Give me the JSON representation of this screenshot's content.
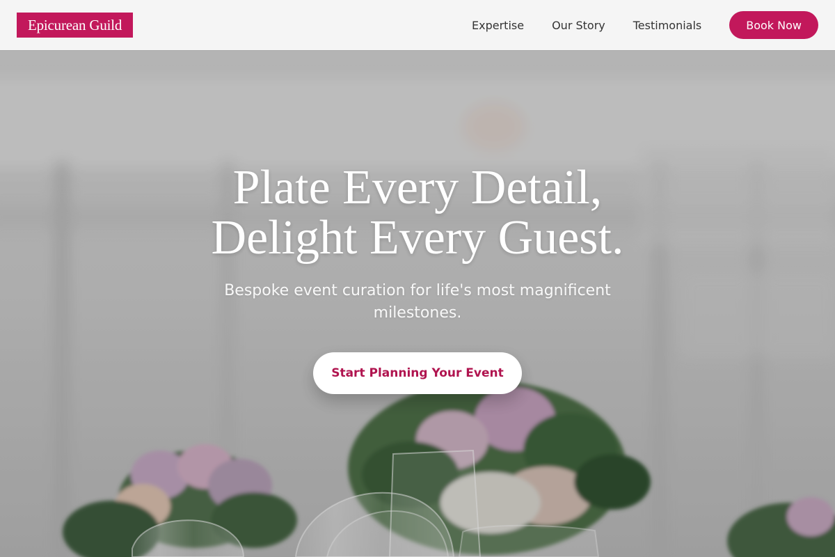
{
  "brand": {
    "name": "Epicurean Guild",
    "color": "#c2185b"
  },
  "nav": {
    "items": [
      {
        "label": "Expertise"
      },
      {
        "label": "Our Story"
      },
      {
        "label": "Testimonials"
      }
    ],
    "book_label": "Book Now"
  },
  "hero": {
    "title_line1": "Plate Every Detail,",
    "title_line2": "Delight Every Guest.",
    "subtitle": "Bespoke event curation for life's most magnificent milestones.",
    "cta_label": "Start Planning Your Event"
  }
}
